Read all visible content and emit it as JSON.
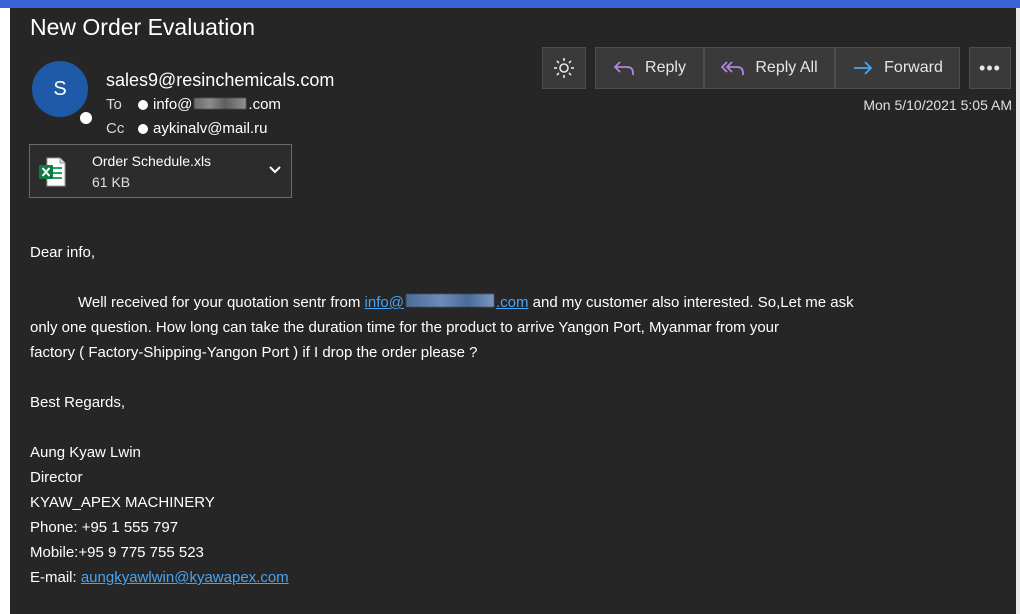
{
  "email": {
    "subject": "New Order Evaluation",
    "avatar_initial": "S",
    "sender": "sales9@resinchemicals.com",
    "to_label": "To",
    "to_prefix": "info@",
    "to_suffix": ".com",
    "cc_label": "Cc",
    "cc_address": "aykinalv@mail.ru",
    "date": "Mon 5/10/2021 5:05 AM"
  },
  "attachment": {
    "name": "Order Schedule.xls",
    "size": "61 KB",
    "icon": "excel-file-icon"
  },
  "toolbar": {
    "theme_icon": "sun-icon",
    "reply_label": "Reply",
    "reply_all_label": "Reply All",
    "forward_label": "Forward",
    "more_label": "•••"
  },
  "body": {
    "greeting": "Dear info,",
    "para_line1_prefix": "Well received for your quotation sentr from ",
    "para_link_prefix": "info@",
    "para_link_suffix": ".com",
    "para_line1_suffix": " and my customer also interested. So,Let me ask",
    "para_line2": "only one question. How long can take the duration time for the product to arrive Yangon Port, Myanmar from your",
    "para_line3": "factory ( Factory-Shipping-Yangon Port ) if I drop the order please ?",
    "closing": "Best Regards,",
    "sig_name": "Aung Kyaw Lwin",
    "sig_title": "Director",
    "sig_company": "KYAW_APEX MACHINERY",
    "sig_phone": "Phone: +95 1 555 797",
    "sig_mobile": "Mobile:+95 9 775 755 523",
    "sig_email_label": "E-mail: ",
    "sig_email": "aungkyawlwin@kyawapex.com"
  },
  "colors": {
    "pane_bg": "#262626",
    "accent_strip": "#3a63d8",
    "link": "#4aa3f0",
    "avatar": "#1e5aa8",
    "button_bg": "#3a3a3a",
    "forward_arrow": "#4aa3f0",
    "reply_arrow": "#b084e0"
  }
}
